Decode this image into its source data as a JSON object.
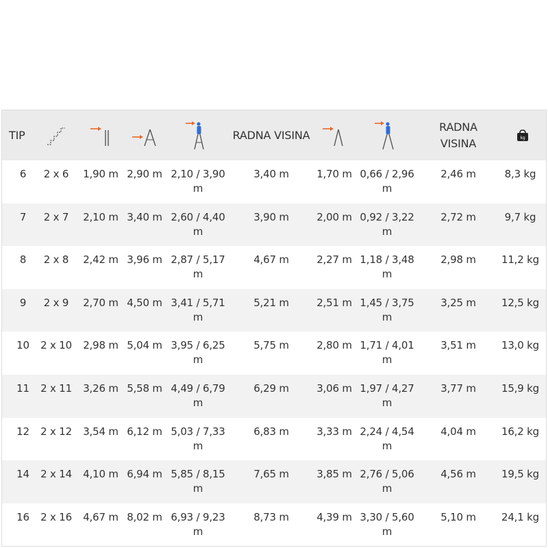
{
  "colors": {
    "header_bg": "#ebebeb",
    "stripe_bg": "#f2f2f2",
    "arrow": "#e8692b",
    "person": "#2f6fd6",
    "icon": "#555555"
  },
  "header": {
    "tip": "TIP",
    "steps_icon": "stairs-icon",
    "closed_icon": "closed-ladder-height-icon",
    "extended_icon": "extended-ladder-length-icon",
    "work_height_icon": "worker-on-ladder-icon",
    "working_height_1": "RADNA VISINA",
    "aframe_icon": "a-frame-ladder-height-icon",
    "aframe_work_icon": "worker-on-a-frame-icon",
    "working_height_2": "RADNA VISINA",
    "weight_icon": "weight-kg-icon",
    "weight_icon_text": "kg"
  },
  "rows": [
    {
      "tip": "6",
      "steps": "2 x 6",
      "closed": "1,90 m",
      "extended": "2,90 m",
      "reach": "2,10 / 3,90 m",
      "work_height": "3,40 m",
      "aframe": "1,70 m",
      "aframe_reach": "0,66 / 2,96 m",
      "aframe_work_height": "2,46 m",
      "weight": "8,3 kg"
    },
    {
      "tip": "7",
      "steps": "2 x 7",
      "closed": "2,10 m",
      "extended": "3,40 m",
      "reach": "2,60 / 4,40 m",
      "work_height": "3,90 m",
      "aframe": "2,00 m",
      "aframe_reach": "0,92 / 3,22 m",
      "aframe_work_height": "2,72 m",
      "weight": "9,7 kg"
    },
    {
      "tip": "8",
      "steps": "2 x 8",
      "closed": "2,42 m",
      "extended": "3,96 m",
      "reach": "2,87 / 5,17 m",
      "work_height": "4,67 m",
      "aframe": "2,27 m",
      "aframe_reach": "1,18 / 3,48 m",
      "aframe_work_height": "2,98 m",
      "weight": "11,2 kg"
    },
    {
      "tip": "9",
      "steps": "2 x 9",
      "closed": "2,70 m",
      "extended": "4,50 m",
      "reach": "3,41 / 5,71 m",
      "work_height": "5,21 m",
      "aframe": "2,51 m",
      "aframe_reach": "1,45 / 3,75 m",
      "aframe_work_height": "3,25 m",
      "weight": "12,5 kg"
    },
    {
      "tip": "10",
      "steps": "2 x 10",
      "closed": "2,98 m",
      "extended": "5,04 m",
      "reach": "3,95 / 6,25 m",
      "work_height": "5,75 m",
      "aframe": "2,80 m",
      "aframe_reach": "1,71 / 4,01 m",
      "aframe_work_height": "3,51 m",
      "weight": "13,0 kg"
    },
    {
      "tip": "11",
      "steps": "2 x 11",
      "closed": "3,26 m",
      "extended": "5,58 m",
      "reach": "4,49 / 6,79 m",
      "work_height": "6,29 m",
      "aframe": "3,06 m",
      "aframe_reach": "1,97 / 4,27 m",
      "aframe_work_height": "3,77 m",
      "weight": "15,9 kg"
    },
    {
      "tip": "12",
      "steps": "2 x 12",
      "closed": "3,54 m",
      "extended": "6,12 m",
      "reach": "5,03 / 7,33 m",
      "work_height": "6,83 m",
      "aframe": "3,33 m",
      "aframe_reach": "2,24 / 4,54 m",
      "aframe_work_height": "4,04 m",
      "weight": "16,2 kg"
    },
    {
      "tip": "14",
      "steps": "2 x 14",
      "closed": "4,10 m",
      "extended": "6,94 m",
      "reach": "5,85 / 8,15 m",
      "work_height": "7,65 m",
      "aframe": "3,85 m",
      "aframe_reach": "2,76 / 5,06 m",
      "aframe_work_height": "4,56 m",
      "weight": "19,5 kg"
    },
    {
      "tip": "16",
      "steps": "2 x 16",
      "closed": "4,67 m",
      "extended": "8,02 m",
      "reach": "6,93 / 9,23 m",
      "work_height": "8,73 m",
      "aframe": "4,39 m",
      "aframe_reach": "3,30 / 5,60 m",
      "aframe_work_height": "5,10 m",
      "weight": "24,1 kg"
    }
  ]
}
